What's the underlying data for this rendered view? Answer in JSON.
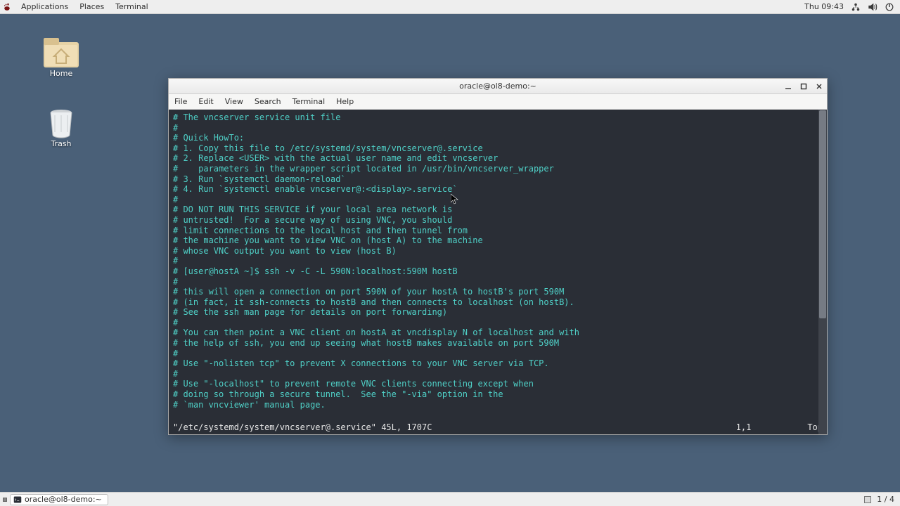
{
  "top_panel": {
    "menu": [
      "Applications",
      "Places",
      "Terminal"
    ],
    "clock": "Thu 09:43"
  },
  "desktop": {
    "home_label": "Home",
    "trash_label": "Trash"
  },
  "terminal_window": {
    "title": "oracle@ol8-demo:~",
    "menubar": [
      "File",
      "Edit",
      "View",
      "Search",
      "Terminal",
      "Help"
    ],
    "lines": [
      "# The vncserver service unit file",
      "#",
      "# Quick HowTo:",
      "# 1. Copy this file to /etc/systemd/system/vncserver@.service",
      "# 2. Replace <USER> with the actual user name and edit vncserver",
      "#    parameters in the wrapper script located in /usr/bin/vncserver_wrapper",
      "# 3. Run `systemctl daemon-reload`",
      "# 4. Run `systemctl enable vncserver@:<display>.service`",
      "#",
      "# DO NOT RUN THIS SERVICE if your local area network is",
      "# untrusted!  For a secure way of using VNC, you should",
      "# limit connections to the local host and then tunnel from",
      "# the machine you want to view VNC on (host A) to the machine",
      "# whose VNC output you want to view (host B)",
      "#",
      "# [user@hostA ~]$ ssh -v -C -L 590N:localhost:590M hostB",
      "#",
      "# this will open a connection on port 590N of your hostA to hostB's port 590M",
      "# (in fact, it ssh-connects to hostB and then connects to localhost (on hostB).",
      "# See the ssh man page for details on port forwarding)",
      "#",
      "# You can then point a VNC client on hostA at vncdisplay N of localhost and with",
      "# the help of ssh, you end up seeing what hostB makes available on port 590M",
      "#",
      "# Use \"-nolisten tcp\" to prevent X connections to your VNC server via TCP.",
      "#",
      "# Use \"-localhost\" to prevent remote VNC clients connecting except when",
      "# doing so through a secure tunnel.  See the \"-via\" option in the",
      "# `man vncviewer' manual page."
    ],
    "status_file": "\"/etc/systemd/system/vncserver@.service\" 45L, 1707C",
    "status_pos": "1,1",
    "status_pct": "Top"
  },
  "taskbar": {
    "task_title": "oracle@ol8-demo:~",
    "workspace": "1 / 4"
  }
}
